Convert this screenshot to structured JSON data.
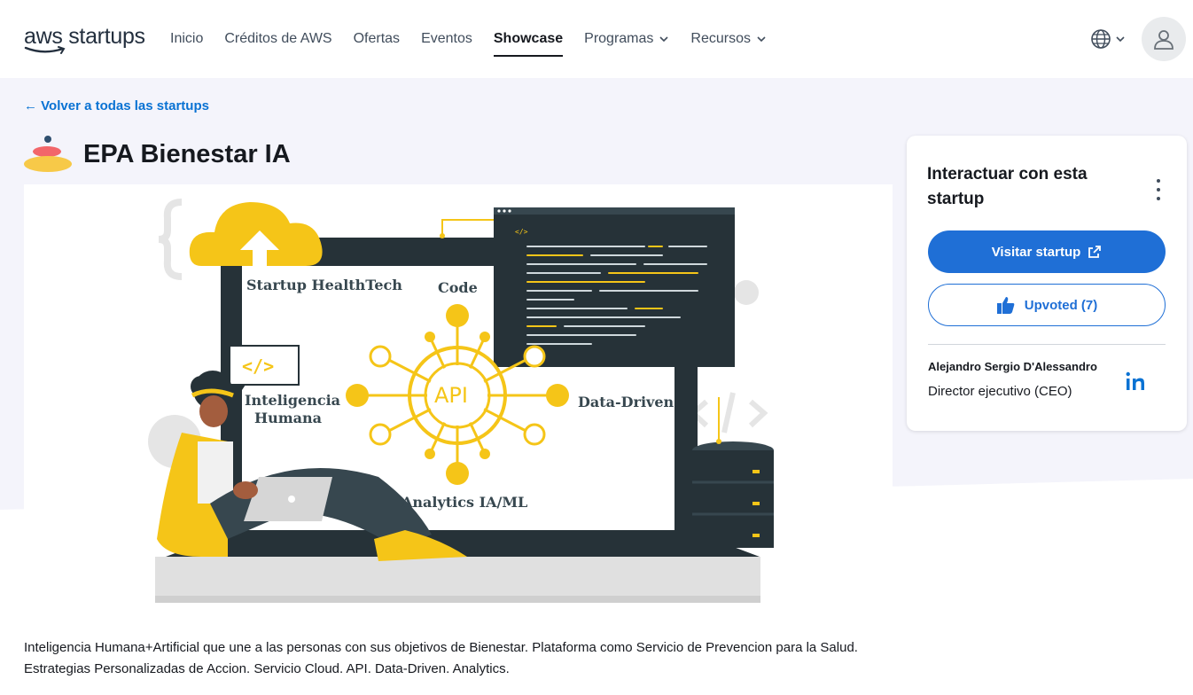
{
  "header": {
    "logo_aws": "aws",
    "logo_startups": "startups",
    "nav": [
      {
        "label": "Inicio",
        "active": false,
        "dropdown": false
      },
      {
        "label": "Créditos de AWS",
        "active": false,
        "dropdown": false
      },
      {
        "label": "Ofertas",
        "active": false,
        "dropdown": false
      },
      {
        "label": "Eventos",
        "active": false,
        "dropdown": false
      },
      {
        "label": "Showcase",
        "active": true,
        "dropdown": false
      },
      {
        "label": "Programas",
        "active": false,
        "dropdown": true
      },
      {
        "label": "Recursos",
        "active": false,
        "dropdown": true
      }
    ],
    "icons": [
      "globe-icon",
      "chevron-down-icon",
      "user-icon"
    ]
  },
  "main": {
    "back_link": "← Volver a todas las startups",
    "title": "EPA Bienestar IA",
    "hero_labels": {
      "healthtech": "Startup HealthTech",
      "code": "Code",
      "api": "API",
      "inteligencia_1": "Inteligencia",
      "inteligencia_2": "Humana",
      "data_driven": "Data-Driven",
      "analytics": "Analytics IA/ML"
    },
    "description": "Inteligencia Humana+Artificial que une a las personas con sus objetivos de Bienestar. Plataforma como Servicio de Prevencion para la Salud. Estrategias Personalizadas de Accion. Servicio Cloud. API. Data-Driven. Analytics."
  },
  "sidebar": {
    "title": "Interactuar con esta startup",
    "visit_button": "Visitar startup",
    "upvote_button": "Upvoted (7)",
    "person_name": "Alejandro Sergio D'Alessandro",
    "person_role": "Director ejecutivo (CEO)"
  },
  "colors": {
    "primary": "#1f6fd6",
    "link": "#0972d3",
    "band": "#f4f4fb",
    "accent_yellow": "#f5c518",
    "dark_screen": "#263238"
  }
}
